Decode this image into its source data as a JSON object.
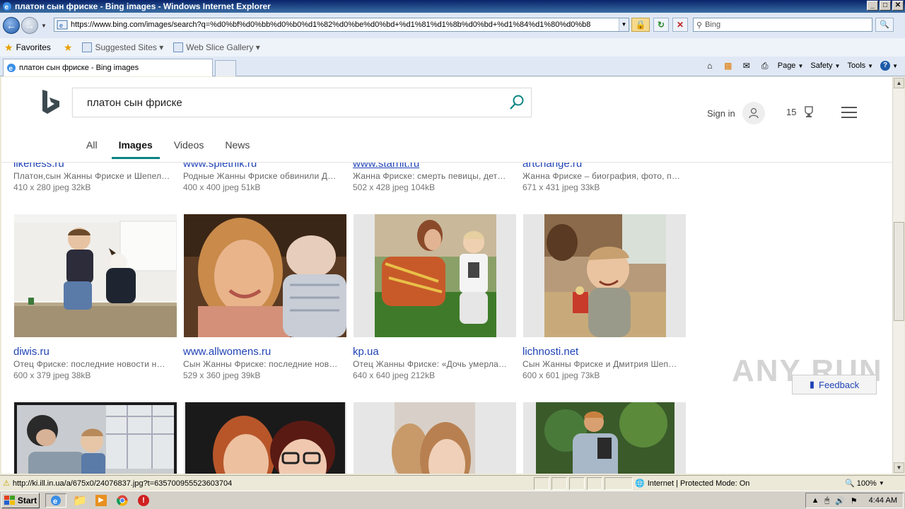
{
  "window": {
    "title": "платон сын фриске - Bing images - Windows Internet Explorer",
    "buttons": [
      "_",
      "□",
      "✕"
    ]
  },
  "addressbar": {
    "url": "https://www.bing.com/images/search?q=%d0%bf%d0%bb%d0%b0%d1%82%d0%be%d0%bd+%d1%81%d1%8b%d0%bd+%d1%84%d1%80%d0%b8",
    "search_placeholder": "Bing"
  },
  "favorites": {
    "label": "Favorites",
    "suggested_sites": "Suggested Sites ▾",
    "web_slice": "Web Slice Gallery ▾"
  },
  "tab": {
    "title": "платон сын фриске - Bing images"
  },
  "commandbar": {
    "page": "Page",
    "safety": "Safety",
    "tools": "Tools"
  },
  "bing": {
    "query": "платон сын фриске",
    "sign_in": "Sign in",
    "rewards_count": "15",
    "scopes": [
      "All",
      "Images",
      "Videos",
      "News"
    ],
    "active_scope": "Images"
  },
  "results": {
    "row1": [
      {
        "source": "likeness.ru",
        "desc": "Платон,сын Жанны Фриске и Шепел…",
        "meta": "410 x 280 jpeg 32kB"
      },
      {
        "source": "www.spletnik.ru",
        "desc": "Родные Жанны Фриске обвинили Д…",
        "meta": "400 x 400 jpeg 51kB"
      },
      {
        "source": "www.starhit.ru",
        "desc": "Жанна Фриске: смерть певицы, дет…",
        "meta": "502 x 428 jpeg 104kB"
      },
      {
        "source": "artchange.ru",
        "desc": "Жанна Фриске – биография, фото, п…",
        "meta": "671 x 431 jpeg 33kB"
      }
    ],
    "row2": [
      {
        "source": "diwis.ru",
        "desc": "Отец Фриске: последние новости н…",
        "meta": "600 x 379 jpeg 38kB"
      },
      {
        "source": "www.allwomens.ru",
        "desc": "Сын Жанны Фриске: последние нов…",
        "meta": "529 x 360 jpeg 39kB"
      },
      {
        "source": "kp.ua",
        "desc": "Отец Жанны Фриске: «Дочь умерла…",
        "meta": "640 x 640 jpeg 212kB"
      },
      {
        "source": "lichnosti.net",
        "desc": "Сын Жанны Фриске и Дмитрия Шеп…",
        "meta": "600 x 601 jpeg 73kB"
      }
    ]
  },
  "feedback": "Feedback",
  "watermark": "ANY RUN",
  "statusbar": {
    "link": "http://ki.ill.in.ua/a/675x0/24076837.jpg?t=635700955523603704",
    "zone": "Internet | Protected Mode: On",
    "zoom": "100%"
  },
  "taskbar": {
    "start": "Start",
    "time": "4:44 AM"
  }
}
